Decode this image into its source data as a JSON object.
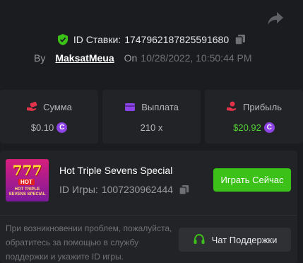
{
  "bet": {
    "id_label": "ID Ставки:",
    "id_value": "1747962187825591680",
    "by_label": "By",
    "username": "MaksatMeua",
    "on_label": "On",
    "date": "10/28/2022, 10:50:44 PM"
  },
  "stats": [
    {
      "label": "Сумма",
      "value": "$0.10",
      "coin": true,
      "color": "#e2334a"
    },
    {
      "label": "Выплата",
      "value": "210 x",
      "coin": false,
      "color": "#8e43e7"
    },
    {
      "label": "Прибыль",
      "value": "$20.92",
      "coin": true,
      "color": "#e2334a",
      "value_color": "#53d233"
    }
  ],
  "coin_symbol": "C",
  "game": {
    "thumb_sevens": "777",
    "thumb_hot": "HOT",
    "thumb_title": "HOT TRIPLE SEVENS SPECIAL",
    "name": "Hot Triple Sevens Special",
    "id_label": "ID Игры:",
    "id_value": "1007230962444",
    "play_label": "Играть Сейчас"
  },
  "support": {
    "help_text": "При возникновении проблем, пожалуйста, обратитесь за помощью в службу поддержки и укажите ID игры.",
    "button_label": "Чат Поддержки"
  },
  "colors": {
    "accent_green": "#3bc117",
    "coin": "#8e43e7",
    "shield": "#3bc117"
  }
}
